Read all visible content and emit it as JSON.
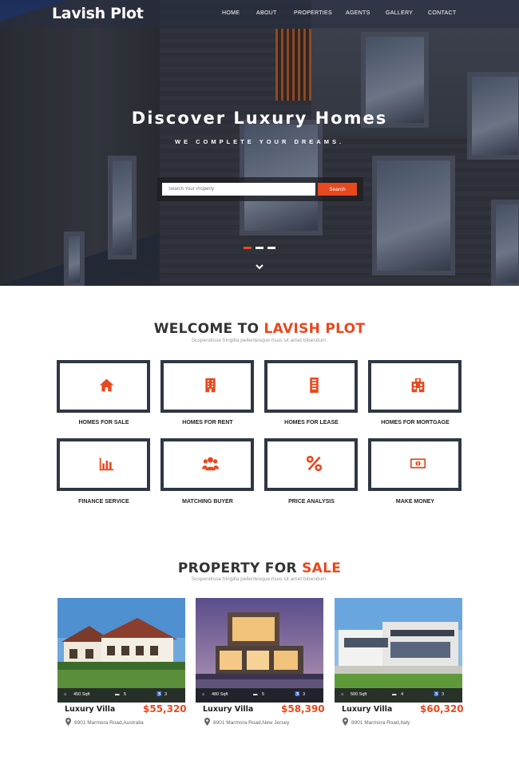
{
  "brand": {
    "name": "Lavish Plot",
    "accent_color": "#e8481e",
    "dark_color": "#2f3744"
  },
  "nav": {
    "items": [
      "HOME",
      "ABOUT",
      "PROPERTIES",
      "AGENTS",
      "GALLERY",
      "CONTACT"
    ]
  },
  "hero": {
    "title": "Discover Luxury Homes",
    "subtitle": "WE COMPLETE YOUR DREAMS.",
    "search_placeholder": "Search Your Property",
    "search_button": "Search",
    "slides": 3,
    "active_slide": 1
  },
  "welcome": {
    "title_plain": "WELCOME TO",
    "title_accent": "LAVISH PLOT",
    "subtitle": "Suspendisse fringilla pellentesque risus sit amet bibendum.",
    "services": [
      {
        "label": "HOMES FOR SALE",
        "icon": "home-icon"
      },
      {
        "label": "HOMES FOR RENT",
        "icon": "building-icon"
      },
      {
        "label": "HOMES FOR LEASE",
        "icon": "tower-icon"
      },
      {
        "label": "HOMES FOR MORTGAGE",
        "icon": "hospital-building-icon"
      },
      {
        "label": "FINANCE SERVICE",
        "icon": "bar-chart-icon"
      },
      {
        "label": "MATCHING BUYER",
        "icon": "users-icon"
      },
      {
        "label": "PRICE ANALYSIS",
        "icon": "percent-icon"
      },
      {
        "label": "MAKE MONEY",
        "icon": "money-icon"
      }
    ]
  },
  "property": {
    "title_plain": "PROPERTY FOR",
    "title_accent": "SALE",
    "subtitle": "Suspendisse fringilla pellentesque risus sit amet bibendum.",
    "listings": [
      {
        "name": "Luxury Villa",
        "price": "$55,320",
        "area": "450 Sqft",
        "beds": "5",
        "baths": "3",
        "address": "8901 Marmora Road,Australia"
      },
      {
        "name": "Luxury Villa",
        "price": "$58,390",
        "area": "480 Sqft",
        "beds": "5",
        "baths": "3",
        "address": "8901 Marmora Road,New Jersey"
      },
      {
        "name": "Luxury Villa",
        "price": "$60,320",
        "area": "500 Sqft",
        "beds": "4",
        "baths": "3",
        "address": "8901 Marmora Road,Italy"
      }
    ]
  }
}
